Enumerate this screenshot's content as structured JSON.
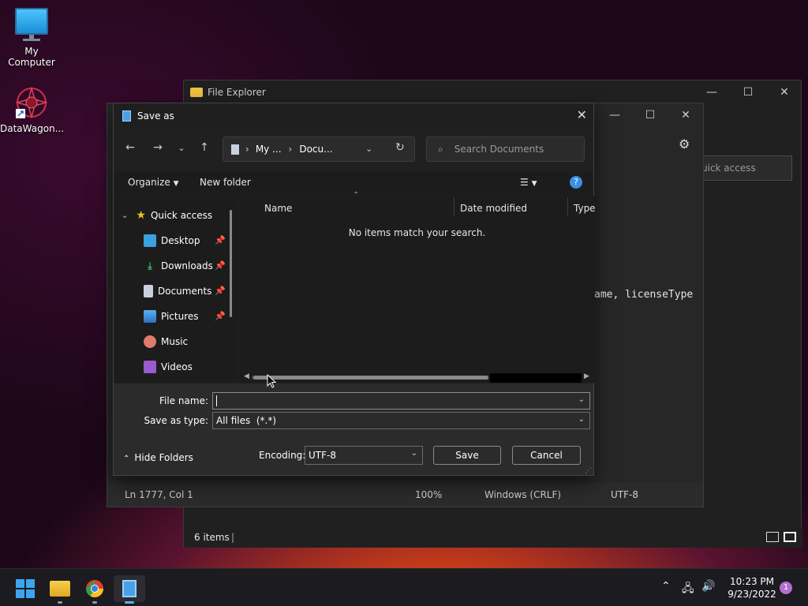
{
  "desktop": {
    "icons": [
      {
        "label": "My Computer"
      },
      {
        "label": "DataWagon..."
      }
    ]
  },
  "explorer": {
    "title": "File Explorer",
    "search_placeholder": "uick access",
    "status_items": "6 items"
  },
  "notepad": {
    "code_fragment": "ame, licenseType",
    "status": {
      "position": "Ln 1777, Col 1",
      "zoom": "100%",
      "line_ending": "Windows (CRLF)",
      "encoding": "UTF-8"
    }
  },
  "dialog": {
    "title": "Save as",
    "breadcrumb": [
      "My ...",
      "Docu..."
    ],
    "search_placeholder": "Search Documents",
    "toolbar": {
      "organize": "Organize",
      "new_folder": "New folder"
    },
    "nav": {
      "quick_access": "Quick access",
      "items": [
        {
          "label": "Desktop",
          "pinned": true
        },
        {
          "label": "Downloads",
          "pinned": true
        },
        {
          "label": "Documents",
          "pinned": true
        },
        {
          "label": "Pictures",
          "pinned": true
        },
        {
          "label": "Music",
          "pinned": false
        },
        {
          "label": "Videos",
          "pinned": false
        }
      ]
    },
    "columns": {
      "name": "Name",
      "date_modified": "Date modified",
      "type": "Type"
    },
    "empty_message": "No items match your search.",
    "form": {
      "file_name_label": "File name:",
      "file_name_value": "",
      "save_as_type_label": "Save as type:",
      "save_as_type_value": "All files  (*.*)",
      "encoding_label": "Encoding:",
      "encoding_value": "UTF-8",
      "hide_folders": "Hide Folders",
      "save": "Save",
      "cancel": "Cancel"
    }
  },
  "taskbar": {
    "time": "10:23 PM",
    "date": "9/23/2022",
    "notification_count": "1"
  },
  "colors": {
    "accent_blue": "#3b8fe0",
    "dialog_bg": "#202020",
    "form_bg": "#2b2b2b"
  }
}
